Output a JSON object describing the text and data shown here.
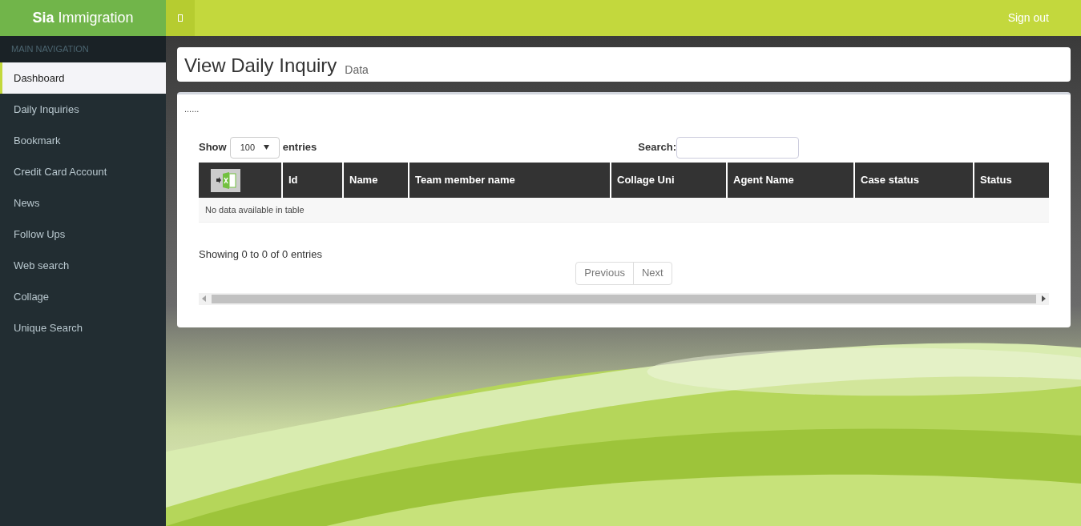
{
  "brand": {
    "bold": "Sia",
    "rest": "Immigration"
  },
  "topbar": {
    "sign_out": "Sign out"
  },
  "sidebar": {
    "header": "MAIN NAVIGATION",
    "items": [
      {
        "label": "Dashboard",
        "selected": true
      },
      {
        "label": "Daily Inquiries",
        "selected": false
      },
      {
        "label": "Bookmark",
        "selected": false
      },
      {
        "label": "Credit Card Account",
        "selected": false
      },
      {
        "label": "News",
        "selected": false
      },
      {
        "label": "Follow Ups",
        "selected": false
      },
      {
        "label": "Web search",
        "selected": false
      },
      {
        "label": "Collage",
        "selected": false
      },
      {
        "label": "Unique Search",
        "selected": false
      }
    ]
  },
  "page_header": {
    "title": "View Daily Inquiry",
    "subtitle": "Data"
  },
  "box": {
    "dots": "......",
    "length": {
      "before": "Show",
      "value": "100",
      "after": "entries"
    },
    "search_label": "Search:",
    "table": {
      "columns": [
        {
          "kind": "export"
        },
        {
          "kind": "text",
          "label": "Id"
        },
        {
          "kind": "text",
          "label": "Name"
        },
        {
          "kind": "text",
          "label": "Team member name"
        },
        {
          "kind": "text",
          "label": "Collage Uni"
        },
        {
          "kind": "text",
          "label": "Agent Name"
        },
        {
          "kind": "text",
          "label": "Case status"
        },
        {
          "kind": "text",
          "label": "Status"
        }
      ],
      "empty": "No data available in table"
    },
    "info": "Showing 0 to 0 of 0 entries",
    "pagination": [
      {
        "label": "Previous",
        "disabled": true
      },
      {
        "label": "Next",
        "disabled": true
      }
    ]
  }
}
